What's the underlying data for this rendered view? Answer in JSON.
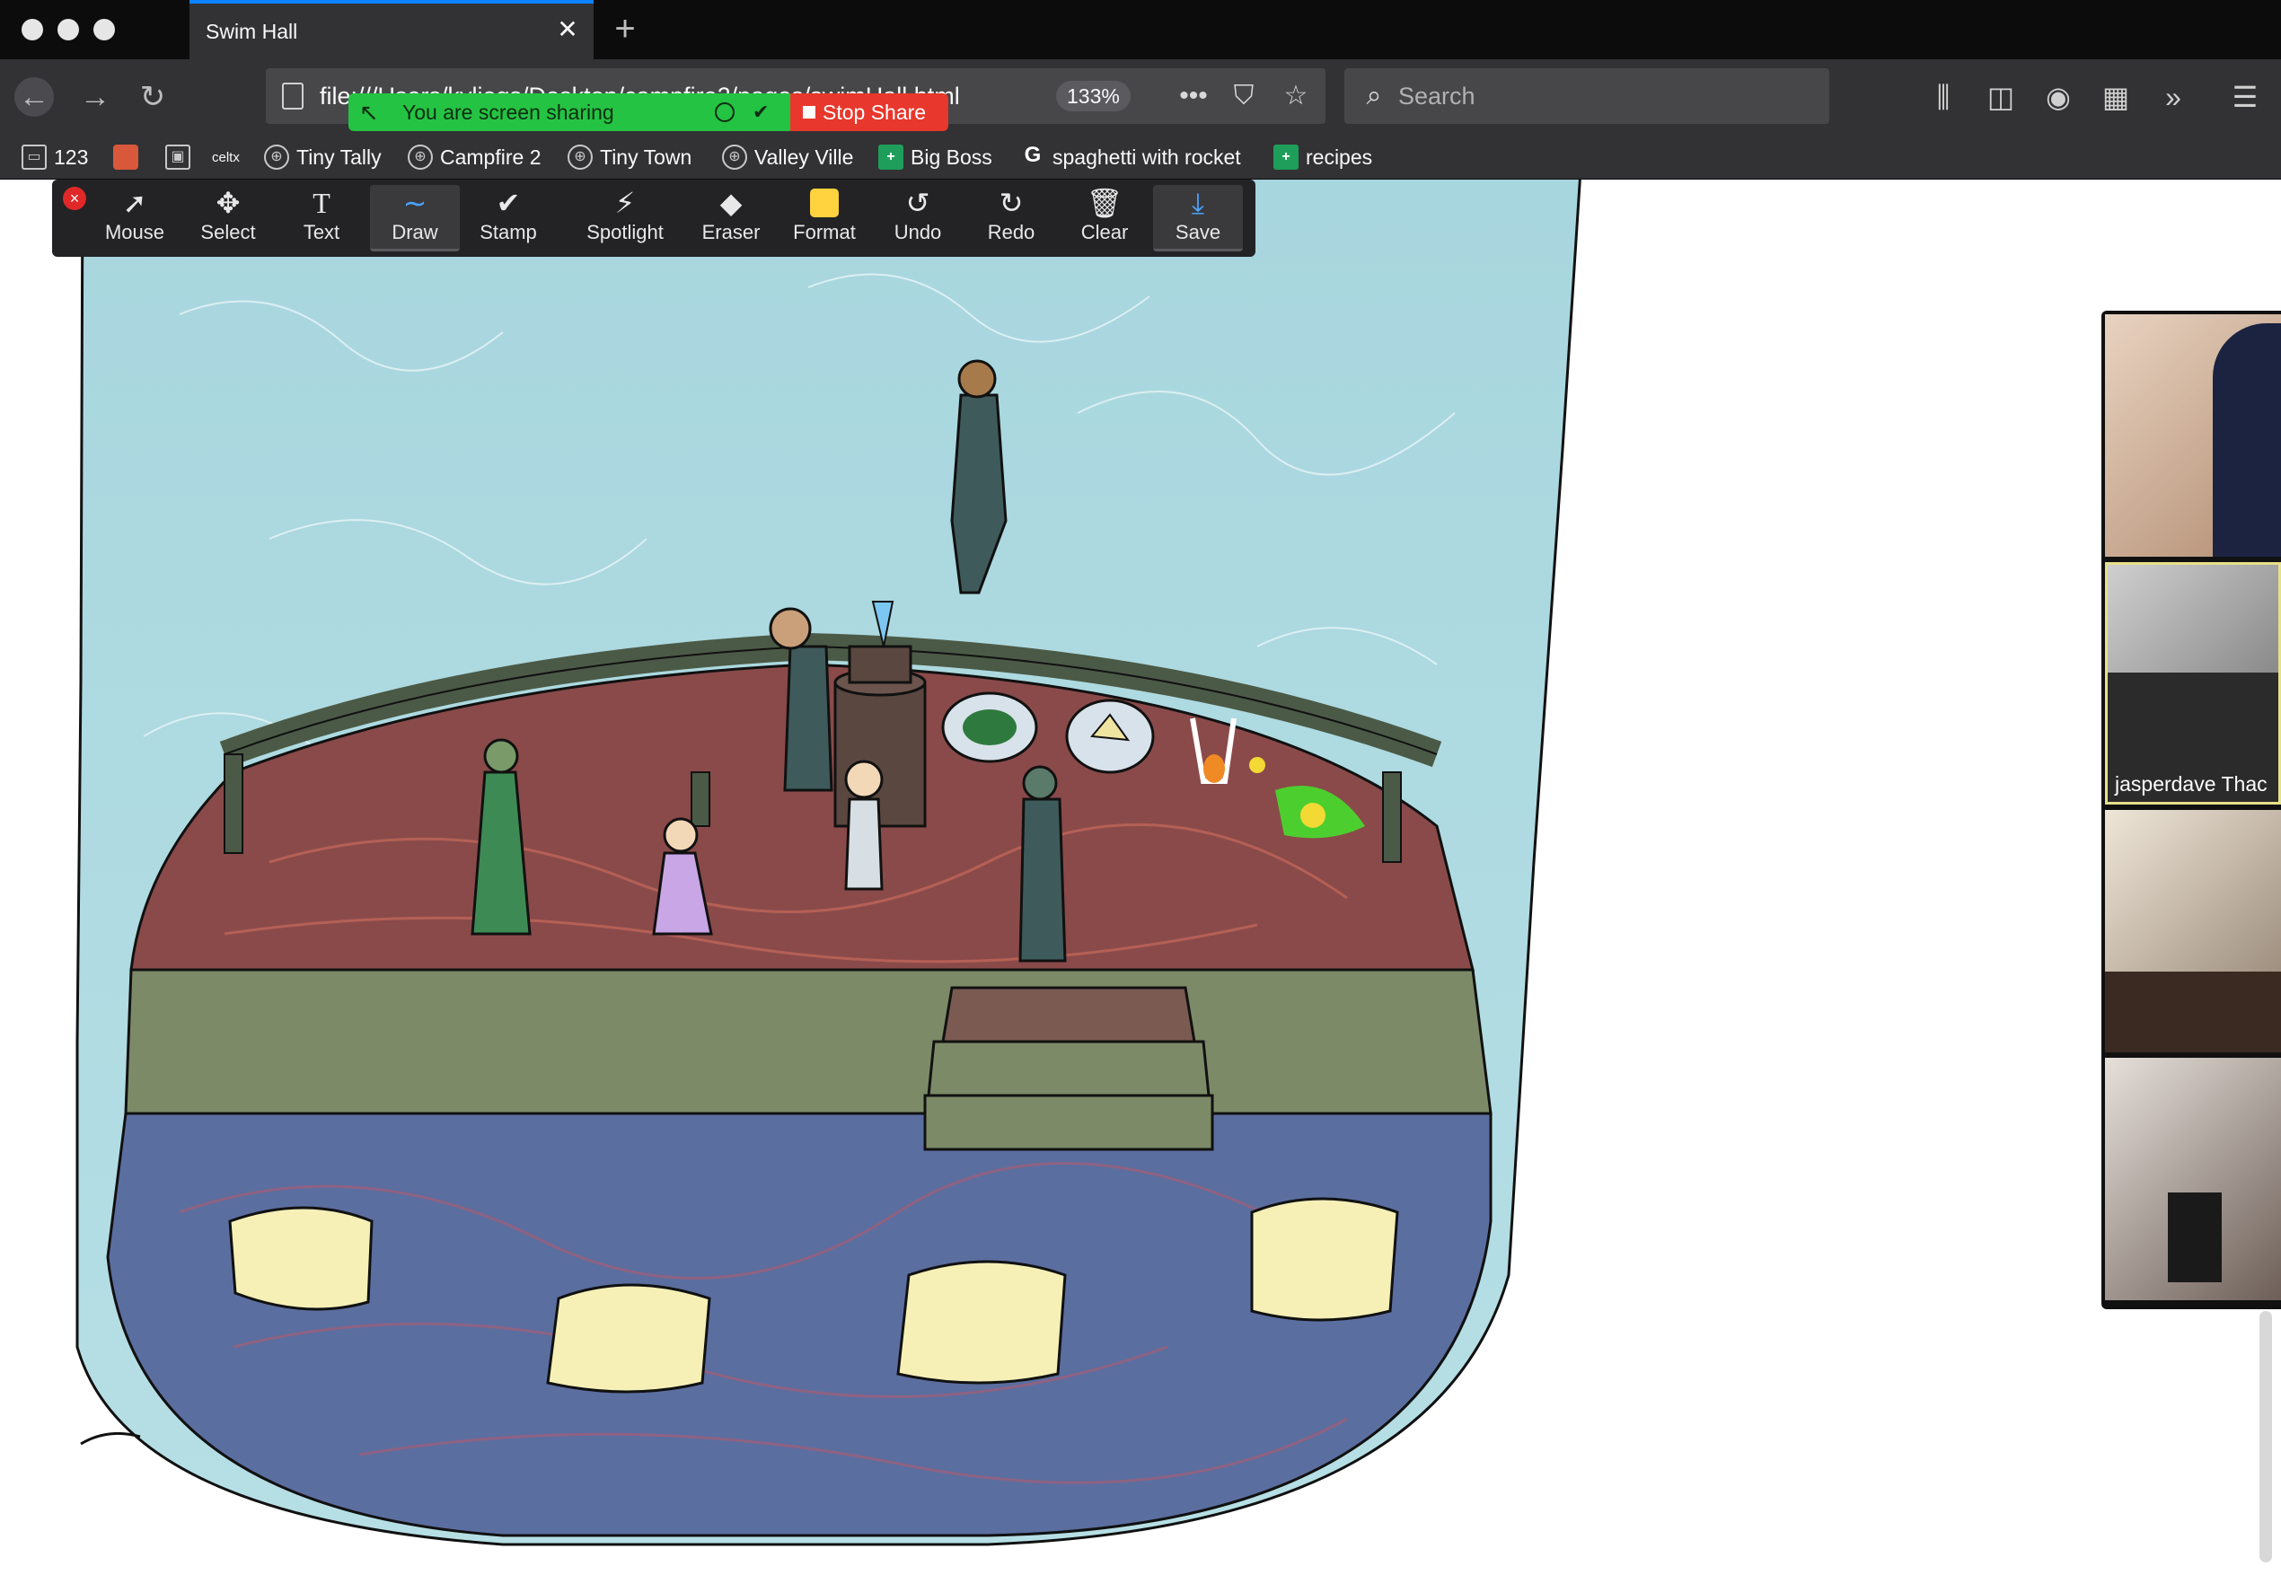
{
  "browser": {
    "tab_title": "Swim Hall",
    "tab_close": "✕",
    "new_tab": "+",
    "url": "file:///Users/kyliegs/Desktop/campfire2/pages/swimHall.html",
    "zoom": "133%",
    "search_placeholder": "Search"
  },
  "bookmarks": [
    {
      "label": "123",
      "icon": "folder-icon"
    },
    {
      "label": "",
      "icon": "app-icon"
    },
    {
      "label": "",
      "icon": "scan-icon"
    },
    {
      "label": "celtx",
      "icon": "celtx-icon"
    },
    {
      "label": "Tiny Tally",
      "icon": "globe-icon"
    },
    {
      "label": "Campfire 2",
      "icon": "globe-icon"
    },
    {
      "label": "Tiny Town",
      "icon": "globe-icon"
    },
    {
      "label": "Valley Ville",
      "icon": "globe-icon"
    },
    {
      "label": "Big Boss",
      "icon": "sheets-icon"
    },
    {
      "label": "spaghetti with rocket",
      "icon": "google-icon"
    },
    {
      "label": "recipes",
      "icon": "sheets-icon"
    }
  ],
  "share": {
    "status": "You are screen sharing",
    "stop_label": "Stop Share"
  },
  "toolbar": {
    "tools": [
      "Mouse",
      "Select",
      "Text",
      "Draw",
      "Stamp",
      "Spotlight",
      "Eraser",
      "Format",
      "Undo",
      "Redo",
      "Clear",
      "Save"
    ],
    "active_tool": "Draw",
    "format_color": "#ffd23f"
  },
  "participants": [
    {
      "name": ""
    },
    {
      "name": "jasperdave Thac"
    },
    {
      "name": ""
    },
    {
      "name": ""
    }
  ]
}
